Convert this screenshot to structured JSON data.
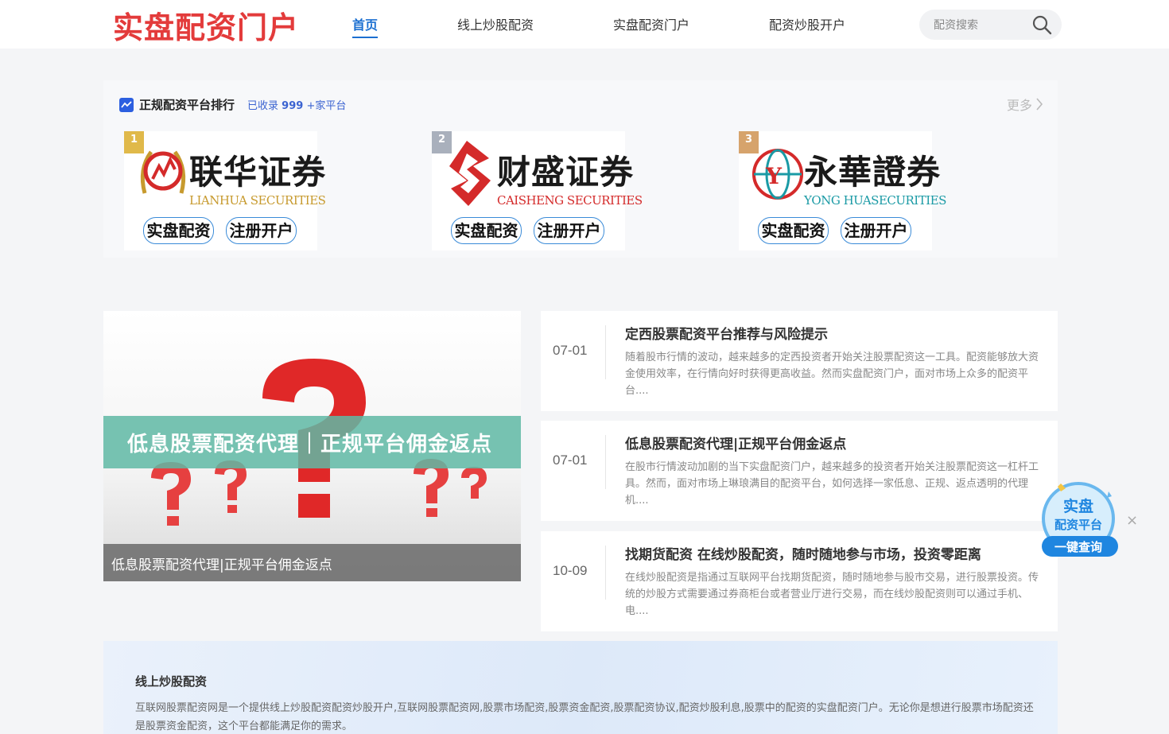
{
  "header": {
    "logo_text": "实盘配资门户",
    "nav": [
      {
        "label": "首页",
        "active": true
      },
      {
        "label": "线上炒股配资",
        "active": false
      },
      {
        "label": "实盘配资门户",
        "active": false
      },
      {
        "label": "配资炒股开户",
        "active": false
      }
    ],
    "search_placeholder": "配资搜索"
  },
  "ranking": {
    "title": "正规配资平台排行",
    "count_prefix": "已收录",
    "count_value": "999",
    "count_suffix": "+家平台",
    "more_label": "更多",
    "brokers": [
      {
        "rank": "1",
        "name": "联华证券",
        "en": "LIANHUA SECURITIES",
        "btn1": "实盘配资",
        "btn2": "注册开户",
        "en_color": "#c79a2e",
        "badge_color": "#e0b94a"
      },
      {
        "rank": "2",
        "name": "财盛证券",
        "en": "CAISHENG SECURITIES",
        "btn1": "实盘配资",
        "btn2": "注册开户",
        "en_color": "#d42a2a",
        "badge_color": "#a9b0bc"
      },
      {
        "rank": "3",
        "name": "永華證券",
        "en": "YONG HUASECURITIES",
        "btn1": "实盘配资",
        "btn2": "注册开户",
        "en_color": "#1a9aa5",
        "badge_color": "#d6a36c"
      }
    ]
  },
  "hero": {
    "banner_text": "低息股票配资代理｜正规平台佣金返点",
    "caption": "低息股票配资代理|正规平台佣金返点"
  },
  "news": [
    {
      "date": "07-01",
      "title": "定西股票配资平台推荐与风险提示",
      "desc": "随着股市行情的波动，越来越多的定西投资者开始关注股票配资这一工具。配资能够放大资金使用效率，在行情向好时获得更高收益。然而实盘配资门户，面对市场上众多的配资平台...."
    },
    {
      "date": "07-01",
      "title": "低息股票配资代理|正规平台佣金返点",
      "desc": "在股市行情波动加剧的当下实盘配资门户，越来越多的投资者开始关注股票配资这一杠杆工具。然而，面对市场上琳琅满目的配资平台，如何选择一家低息、正规、返点透明的代理机...."
    },
    {
      "date": "10-09",
      "title": "找期货配资 在线炒股配资，随时随地参与市场，投资零距离",
      "desc": "在线炒股配资是指通过互联网平台找期货配资，随时随地参与股市交易，进行股票投资。传统的炒股方式需要通过券商柜台或者营业厅进行交易，而在线炒股配资则可以通过手机、电...."
    }
  ],
  "float_badge": {
    "line1": "实盘",
    "line2": "配资平台",
    "line3": "一键查询"
  },
  "intro": {
    "title": "线上炒股配资",
    "text": "互联网股票配资网是一个提供线上炒股配资配资炒股开户,互联网股票配资网,股票市场配资,股票资金配资,股票配资协议,配资炒股利息,股票中的配资的实盘配资门户。无论你是想进行股票市场配资还是股票资金配资，这个平台都能满足你的需求。"
  }
}
